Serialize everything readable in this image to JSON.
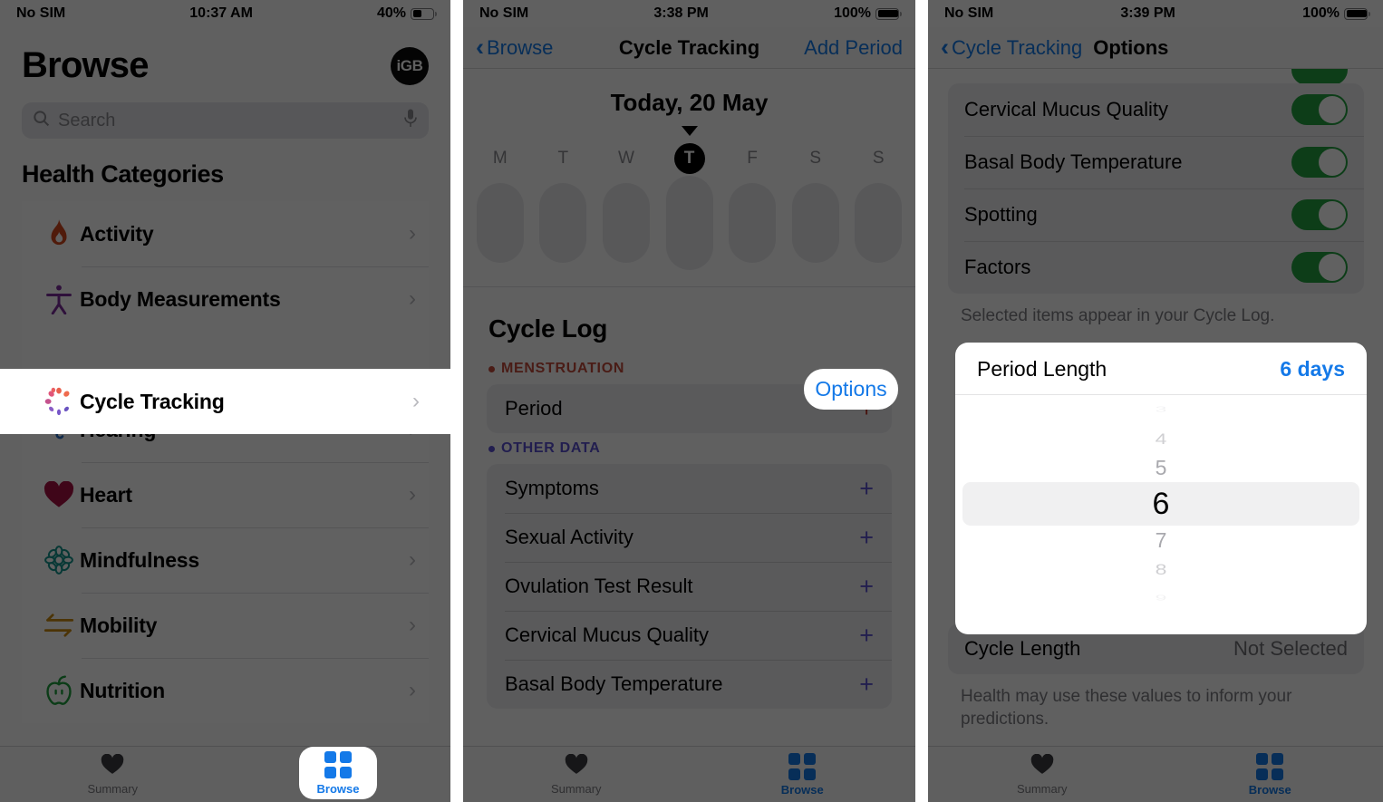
{
  "panel1": {
    "status": {
      "carrier": "No SIM",
      "time": "10:37 AM",
      "battery_pct": "40%",
      "battery_level": 40
    },
    "title": "Browse",
    "logo": "iGB",
    "search": {
      "placeholder": "Search",
      "icon": "search-icon",
      "mic_icon": "microphone-icon"
    },
    "section_header": "Health Categories",
    "categories": [
      {
        "label": "Activity",
        "icon": "flame-icon",
        "color": "#d1471e"
      },
      {
        "label": "Body Measurements",
        "icon": "person-icon",
        "color": "#7b2d9c"
      },
      {
        "label": "Cycle Tracking",
        "icon": "cycle-icon",
        "color": "#e0557a",
        "highlighted": true
      },
      {
        "label": "Hearing",
        "icon": "ear-icon",
        "color": "#2a6fc4"
      },
      {
        "label": "Heart",
        "icon": "heart-icon",
        "color": "#a61243"
      },
      {
        "label": "Mindfulness",
        "icon": "mindfulness-icon",
        "color": "#14938c"
      },
      {
        "label": "Mobility",
        "icon": "mobility-icon",
        "color": "#c98a12"
      },
      {
        "label": "Nutrition",
        "icon": "apple-icon",
        "color": "#1f9e3e"
      }
    ],
    "tabs": [
      {
        "label": "Summary",
        "icon": "heart-icon",
        "active": false
      },
      {
        "label": "Browse",
        "icon": "grid-icon",
        "active": true,
        "highlighted": true
      }
    ]
  },
  "panel2": {
    "status": {
      "carrier": "No SIM",
      "time": "3:38 PM",
      "battery_pct": "100%",
      "battery_level": 100
    },
    "nav": {
      "back": "Browse",
      "title": "Cycle Tracking",
      "right": "Add Period",
      "back_icon": "chevron-left-icon"
    },
    "today": "Today, 20 May",
    "week_days": [
      "M",
      "T",
      "W",
      "T",
      "F",
      "S",
      "S"
    ],
    "today_index": 3,
    "log": {
      "title": "Cycle Log",
      "options_button": "Options",
      "groups": [
        {
          "label": "MENSTRUATION",
          "color": "#c24a3a",
          "rows": [
            {
              "label": "Period",
              "action": "+"
            }
          ]
        },
        {
          "label": "OTHER DATA",
          "color": "#5a4fcf",
          "rows": [
            {
              "label": "Symptoms",
              "action": "+"
            },
            {
              "label": "Sexual Activity",
              "action": "+"
            },
            {
              "label": "Ovulation Test Result",
              "action": "+"
            },
            {
              "label": "Cervical Mucus Quality",
              "action": "+"
            },
            {
              "label": "Basal Body Temperature",
              "action": "+"
            }
          ]
        }
      ]
    },
    "tabs": [
      {
        "label": "Summary",
        "icon": "heart-icon",
        "active": false
      },
      {
        "label": "Browse",
        "icon": "grid-icon",
        "active": true
      }
    ]
  },
  "panel3": {
    "status": {
      "carrier": "No SIM",
      "time": "3:39 PM",
      "battery_pct": "100%",
      "battery_level": 100
    },
    "nav": {
      "back": "Cycle Tracking",
      "title": "Options",
      "back_icon": "chevron-left-icon"
    },
    "toggles": [
      {
        "label": "Cervical Mucus Quality",
        "on": true
      },
      {
        "label": "Basal Body Temperature",
        "on": true
      },
      {
        "label": "Spotting",
        "on": true
      },
      {
        "label": "Factors",
        "on": true
      }
    ],
    "toggles_footnote": "Selected items appear in your Cycle Log.",
    "picker": {
      "label": "Period Length",
      "value": "6 days",
      "options": [
        "3",
        "4",
        "5",
        "6",
        "7",
        "8",
        "9"
      ],
      "selected": "6",
      "highlighted": true
    },
    "cycle_length": {
      "label": "Cycle Length",
      "value": "Not Selected"
    },
    "footnote": "Health may use these values to inform your predictions.",
    "tabs": [
      {
        "label": "Summary",
        "icon": "heart-icon",
        "active": false
      },
      {
        "label": "Browse",
        "icon": "grid-icon",
        "active": true
      }
    ]
  },
  "colors": {
    "accent": "#1479e8",
    "toggle_on": "#22a03f",
    "menstruation": "#c24a3a",
    "other_data": "#5a4fcf"
  }
}
